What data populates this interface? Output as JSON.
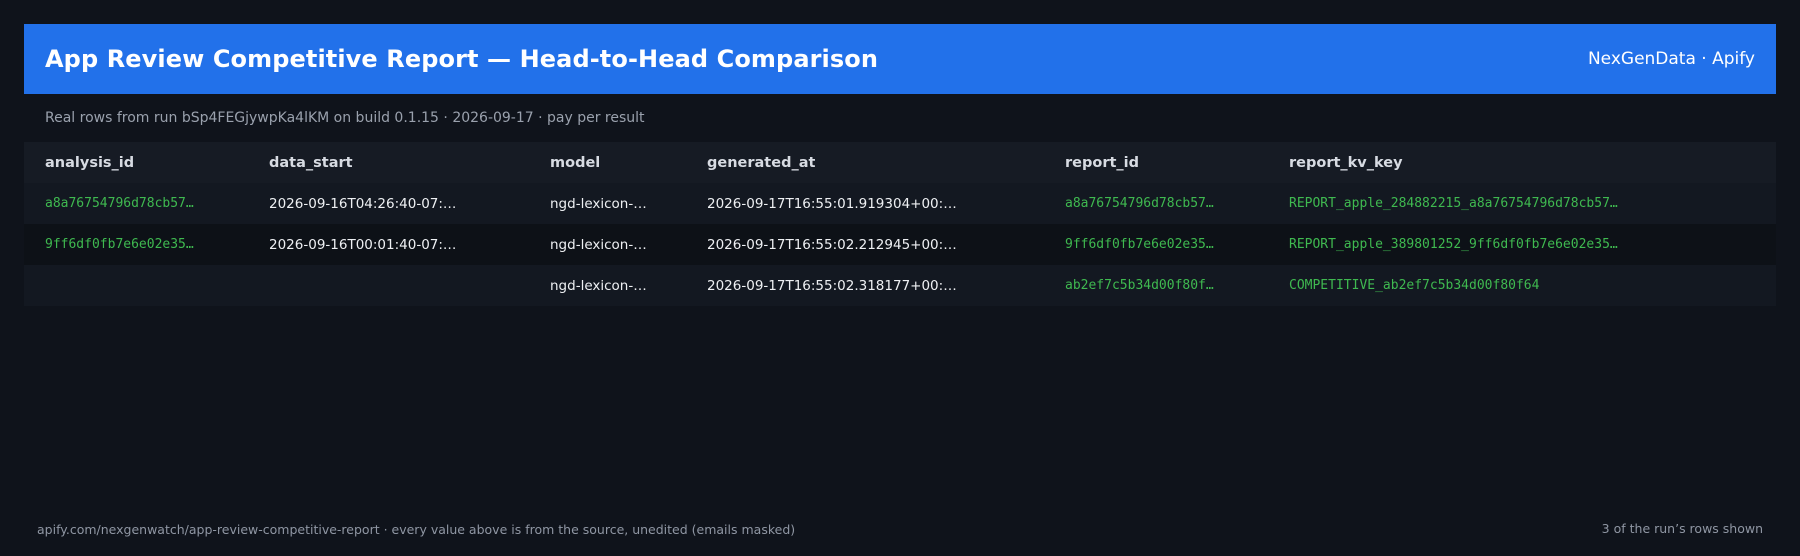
{
  "header": {
    "title": "App Review Competitive Report — Head-to-Head Comparison",
    "brand": "NexGenData · Apify"
  },
  "subtitle": "Real rows from run bSp4FEGjywpKa4lKM on build 0.1.15 · 2026-09-17 · pay per result",
  "table": {
    "columns": [
      "analysis_id",
      "data_start",
      "model",
      "generated_at",
      "report_id",
      "report_kv_key"
    ],
    "rows": [
      {
        "analysis_id": "a8a76754796d78cb57…",
        "data_start": "2026-09-16T04:26:40-07:…",
        "model": "ngd-lexicon-…",
        "generated_at": "2026-09-17T16:55:01.919304+00:…",
        "report_id": "a8a76754796d78cb57…",
        "report_kv_key": "REPORT_apple_284882215_a8a76754796d78cb57…"
      },
      {
        "analysis_id": "9ff6df0fb7e6e02e35…",
        "data_start": "2026-09-16T00:01:40-07:…",
        "model": "ngd-lexicon-…",
        "generated_at": "2026-09-17T16:55:02.212945+00:…",
        "report_id": "9ff6df0fb7e6e02e35…",
        "report_kv_key": "REPORT_apple_389801252_9ff6df0fb7e6e02e35…"
      },
      {
        "analysis_id": "",
        "data_start": "",
        "model": "ngd-lexicon-…",
        "generated_at": "2026-09-17T16:55:02.318177+00:…",
        "report_id": "ab2ef7c5b34d00f80f…",
        "report_kv_key": "COMPETITIVE_ab2ef7c5b34d00f80f64"
      }
    ]
  },
  "footer": {
    "left": "apify.com/nexgenwatch/app-review-competitive-report  ·  every value above is from the source, unedited (emails masked)",
    "right": "3 of the run’s rows shown"
  },
  "colors": {
    "header_bg": "#2271ea",
    "page_bg": "#0f131b",
    "id_green": "#3fb950"
  }
}
